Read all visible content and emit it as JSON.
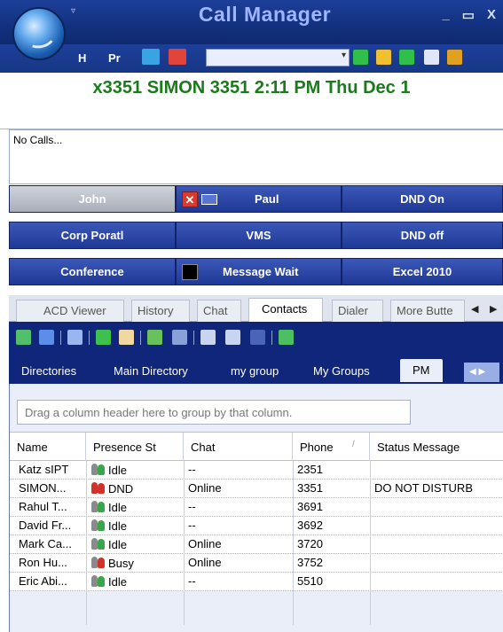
{
  "window": {
    "title": "Call Manager",
    "minimize_glyph": "_",
    "maximize_glyph": "▭",
    "close_glyph": "X",
    "quick_access_glyph": "▿"
  },
  "toolbar": {
    "h_label": "H",
    "pr_label": "Pr",
    "combo_value": "",
    "combo_arrow": "▾"
  },
  "banner": {
    "text": "x3351 SIMON 3351  2:11 PM Thu Dec 1"
  },
  "calls": {
    "text": "No Calls..."
  },
  "speed_buttons": {
    "john": "John",
    "paul": "Paul",
    "dnd_on": "DND On",
    "corp_portal": "Corp Poratl",
    "vms": "VMS",
    "dnd_off": "DND off",
    "conference": "Conference",
    "message_wait": "Message Wait",
    "excel": "Excel 2010"
  },
  "tabs": [
    {
      "label": "ACD Viewer"
    },
    {
      "label": "History"
    },
    {
      "label": "Chat"
    },
    {
      "label": "Contacts"
    },
    {
      "label": "Dialer"
    },
    {
      "label": "More Butte"
    }
  ],
  "tab_nav": {
    "left": "◀",
    "right": "▶"
  },
  "directory_tabs": [
    {
      "label": "Directories"
    },
    {
      "label": "Main Directory"
    },
    {
      "label": "my group"
    },
    {
      "label": "My Groups"
    },
    {
      "label": "PM"
    }
  ],
  "directory_nav": "◀ ▶",
  "group_hint": "Drag a column header here to group by that column.",
  "columns": {
    "name": "Name",
    "presence": "Presence St",
    "chat": "Chat",
    "phone": "Phone",
    "status": "Status Message",
    "sort_indicator": "/"
  },
  "contacts": [
    {
      "name": "Katz sIPT",
      "presence": "Idle",
      "presence_state": "idle",
      "chat": "--",
      "phone": "2351",
      "status": ""
    },
    {
      "name": "SIMON...",
      "presence": "DND",
      "presence_state": "dnd",
      "chat": "Online",
      "phone": "3351",
      "status": "DO NOT DISTURB"
    },
    {
      "name": "Rahul T...",
      "presence": "Idle",
      "presence_state": "idle",
      "chat": "--",
      "phone": "3691",
      "status": ""
    },
    {
      "name": "David Fr...",
      "presence": "Idle",
      "presence_state": "idle",
      "chat": "--",
      "phone": "3692",
      "status": ""
    },
    {
      "name": "Mark Ca...",
      "presence": "Idle",
      "presence_state": "idle",
      "chat": "Online",
      "phone": "3720",
      "status": ""
    },
    {
      "name": "Ron Hu...",
      "presence": "Busy",
      "presence_state": "busy",
      "chat": "Online",
      "phone": "3752",
      "status": ""
    },
    {
      "name": "Eric Abi...",
      "presence": "Idle",
      "presence_state": "idle",
      "chat": "--",
      "phone": "5510",
      "status": ""
    }
  ],
  "colors": {
    "title_bar": "#12307e",
    "banner_text": "#1b7a1b",
    "button_blue": "#1e3895",
    "idle_green": "#3aa64a",
    "busy_red": "#d2322a"
  }
}
